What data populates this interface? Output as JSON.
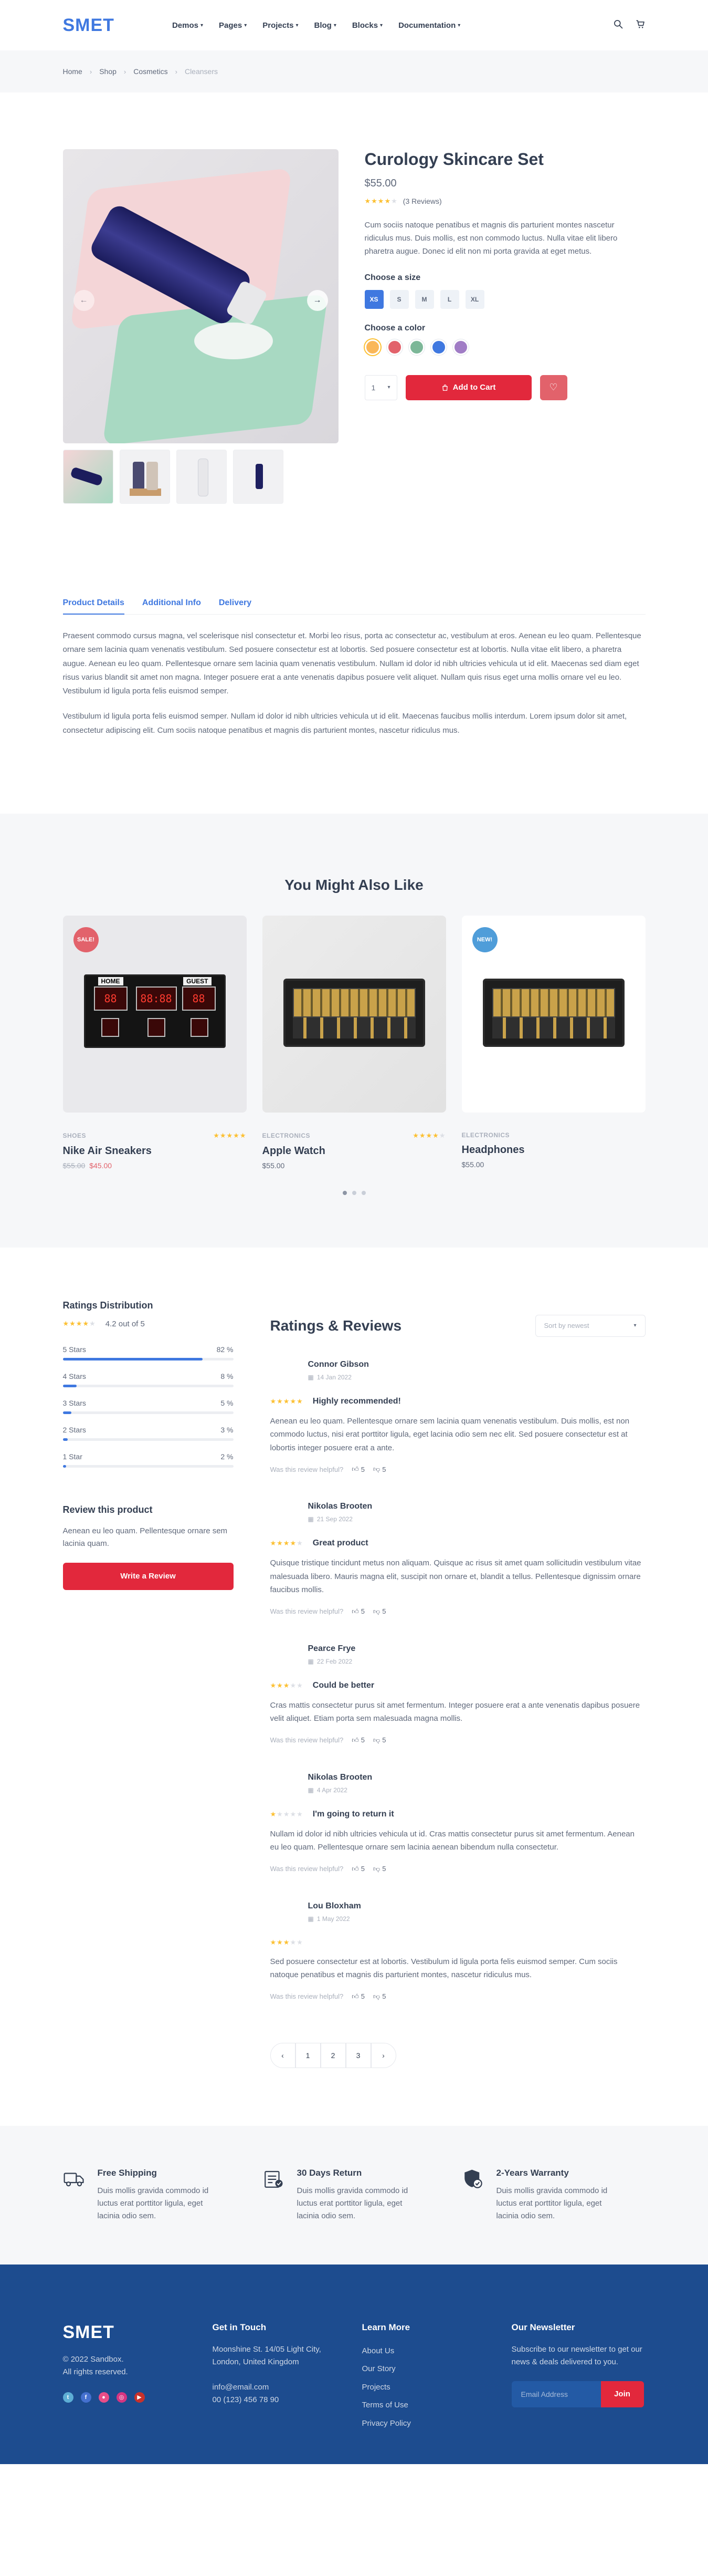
{
  "header": {
    "logo": "SMET",
    "nav": [
      "Demos",
      "Pages",
      "Projects",
      "Blog",
      "Blocks",
      "Documentation"
    ]
  },
  "breadcrumb": [
    "Home",
    "Shop",
    "Cosmetics",
    "Cleansers"
  ],
  "product": {
    "title": "Curology Skincare Set",
    "price": "$55.00",
    "reviews_count": "(3 Reviews)",
    "rating": 4,
    "description": "Cum sociis natoque penatibus et magnis dis parturient montes nascetur ridiculus mus. Duis mollis, est non commodo luctus. Nulla vitae elit libero pharetra augue. Donec id elit non mi porta gravida at eget metus.",
    "size_label": "Choose a size",
    "sizes": [
      "XS",
      "S",
      "M",
      "L",
      "XL"
    ],
    "active_size": "XS",
    "color_label": "Choose a color",
    "colors": [
      "#fab758",
      "#e2626b",
      "#7cb798",
      "#3f78e0",
      "#a07cc5"
    ],
    "quantity": "1",
    "add_to_cart": "Add to Cart",
    "accent": "#e2283c"
  },
  "tabs": {
    "items": [
      "Product Details",
      "Additional Info",
      "Delivery"
    ],
    "p1": "Praesent commodo cursus magna, vel scelerisque nisl consectetur et. Morbi leo risus, porta ac consectetur ac, vestibulum at eros. Aenean eu leo quam. Pellentesque ornare sem lacinia quam venenatis vestibulum. Sed posuere consectetur est at lobortis. Sed posuere consectetur est at lobortis. Nulla vitae elit libero, a pharetra augue. Aenean eu leo quam. Pellentesque ornare sem lacinia quam venenatis vestibulum. Nullam id dolor id nibh ultricies vehicula ut id elit. Maecenas sed diam eget risus varius blandit sit amet non magna. Integer posuere erat a ante venenatis dapibus posuere velit aliquet. Nullam quis risus eget urna mollis ornare vel eu leo. Vestibulum id ligula porta felis euismod semper.",
    "p2": "Vestibulum id ligula porta felis euismod semper. Nullam id dolor id nibh ultricies vehicula ut id elit. Maecenas faucibus mollis interdum. Lorem ipsum dolor sit amet, consectetur adipiscing elit. Cum sociis natoque penatibus et magnis dis parturient montes, nascetur ridiculus mus."
  },
  "related": {
    "title": "You Might Also Like",
    "cards": [
      {
        "badge": "SALE!",
        "category": "Shoes",
        "name": "Nike Air Sneakers",
        "old_price": "$55.00",
        "price": "$45.00",
        "rating": 5,
        "image": "scoreboard"
      },
      {
        "badge": "",
        "category": "Electronics",
        "name": "Apple Watch",
        "old_price": "",
        "price": "$55.00",
        "rating": 4,
        "image": "control-panel"
      },
      {
        "badge": "NEW!",
        "category": "Electronics",
        "name": "Headphones",
        "old_price": "",
        "price": "$55.00",
        "rating": 0,
        "image": "control-panel"
      }
    ],
    "scoreboard": {
      "home": "HOME",
      "guest": "GUEST",
      "home_score": "88",
      "clock": "88:88",
      "guest_score": "88"
    }
  },
  "ratings": {
    "title": "Ratings Distribution",
    "average": "4.2 out of 5",
    "rows": [
      {
        "label": "5 Stars",
        "pct": "82 %",
        "value": 82
      },
      {
        "label": "4 Stars",
        "pct": "8 %",
        "value": 8
      },
      {
        "label": "3 Stars",
        "pct": "5 %",
        "value": 5
      },
      {
        "label": "2 Stars",
        "pct": "3 %",
        "value": 3
      },
      {
        "label": "1 Star",
        "pct": "2 %",
        "value": 2
      }
    ],
    "review_title": "Review this product",
    "review_text": "Aenean eu leo quam. Pellentesque ornare sem lacinia quam.",
    "write_button": "Write a Review"
  },
  "reviews": {
    "title": "Ratings & Reviews",
    "sort": "Sort by newest",
    "helpful_label": "Was this review helpful?",
    "items": [
      {
        "name": "Connor Gibson",
        "date": "14 Jan 2022",
        "rating": 5,
        "title": "Highly recommended!",
        "body": "Aenean eu leo quam. Pellentesque ornare sem lacinia quam venenatis vestibulum. Duis mollis, est non commodo luctus, nisi erat porttitor ligula, eget lacinia odio sem nec elit. Sed posuere consectetur est at lobortis integer posuere erat a ante.",
        "up": "5",
        "down": "5"
      },
      {
        "name": "Nikolas Brooten",
        "date": "21 Sep 2022",
        "rating": 4,
        "title": "Great product",
        "body": "Quisque tristique tincidunt metus non aliquam. Quisque ac risus sit amet quam sollicitudin vestibulum vitae malesuada libero. Mauris magna elit, suscipit non ornare et, blandit a tellus. Pellentesque dignissim ornare faucibus mollis.",
        "up": "5",
        "down": "5"
      },
      {
        "name": "Pearce Frye",
        "date": "22 Feb 2022",
        "rating": 3,
        "title": "Could be better",
        "body": "Cras mattis consectetur purus sit amet fermentum. Integer posuere erat a ante venenatis dapibus posuere velit aliquet. Etiam porta sem malesuada magna mollis.",
        "up": "5",
        "down": "5"
      },
      {
        "name": "Nikolas Brooten",
        "date": "4 Apr 2022",
        "rating": 1,
        "title": "I'm going to return it",
        "body": "Nullam id dolor id nibh ultricies vehicula ut id. Cras mattis consectetur purus sit amet fermentum. Aenean eu leo quam. Pellentesque ornare sem lacinia aenean bibendum nulla consectetur.",
        "up": "5",
        "down": "5"
      },
      {
        "name": "Lou Bloxham",
        "date": "1 May 2022",
        "rating": 3,
        "title": "",
        "body": "Sed posuere consectetur est at lobortis. Vestibulum id ligula porta felis euismod semper. Cum sociis natoque penatibus et magnis dis parturient montes, nascetur ridiculus mus.",
        "up": "5",
        "down": "5"
      }
    ],
    "pages": [
      "‹",
      "1",
      "2",
      "3",
      "›"
    ]
  },
  "features": [
    {
      "icon": "truck-icon",
      "title": "Free Shipping",
      "text": "Duis mollis gravida commodo id luctus erat porttitor ligula, eget lacinia odio sem."
    },
    {
      "icon": "return-icon",
      "title": "30 Days Return",
      "text": "Duis mollis gravida commodo id luctus erat porttitor ligula, eget lacinia odio sem."
    },
    {
      "icon": "shield-icon",
      "title": "2-Years Warranty",
      "text": "Duis mollis gravida commodo id luctus erat porttitor ligula, eget lacinia odio sem."
    }
  ],
  "footer": {
    "logo": "SMET",
    "copyright": "© 2022 Sandbox.",
    "rights": "All rights reserved.",
    "touch_title": "Get in Touch",
    "address": "Moonshine St. 14/05 Light City, London, United Kingdom",
    "email": "info@email.com",
    "phone": "00 (123) 456 78 90",
    "learn_title": "Learn More",
    "links": [
      "About Us",
      "Our Story",
      "Projects",
      "Terms of Use",
      "Privacy Policy"
    ],
    "news_title": "Our Newsletter",
    "news_text": "Subscribe to our newsletter to get our news & deals delivered to you.",
    "email_placeholder": "Email Address",
    "join": "Join",
    "footer_bg": "#1d4c8f"
  }
}
